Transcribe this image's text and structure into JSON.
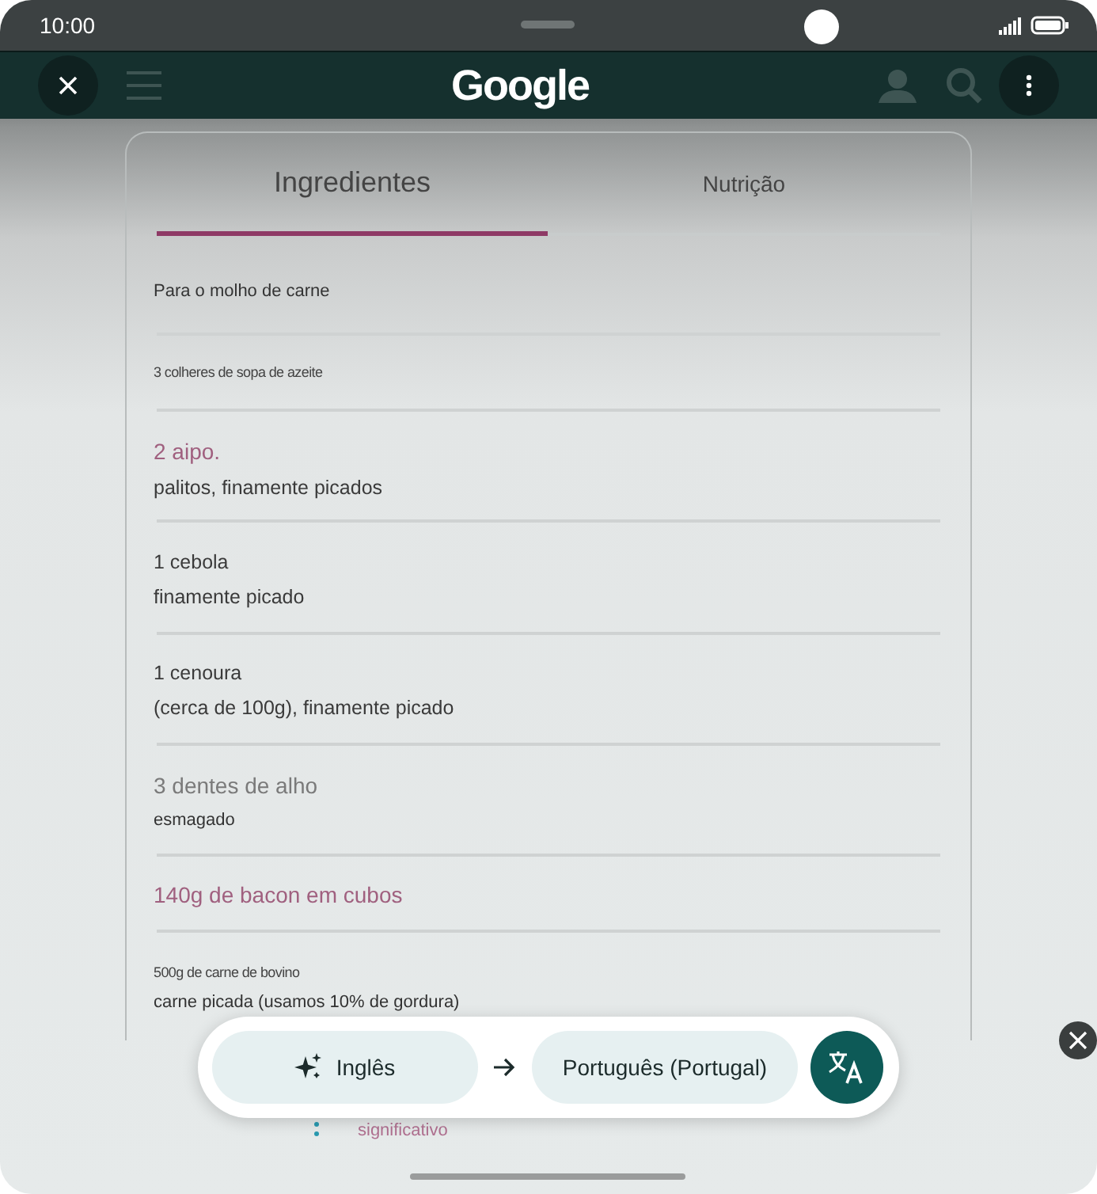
{
  "status_bar": {
    "time": "10:00"
  },
  "header": {
    "logo": "Google"
  },
  "tabs": [
    {
      "label": "Ingredientes",
      "selected": true
    },
    {
      "label": "Nutrição",
      "selected": false
    }
  ],
  "ingredients": [
    {
      "lines": [
        {
          "text": "Para o molho de carne",
          "kind": "small"
        }
      ]
    },
    {
      "lines": [
        {
          "text": "3 colheres de sopa de azeite",
          "kind": "tiny"
        }
      ]
    },
    {
      "lines": [
        {
          "text": "2 aipo.",
          "kind": "accent"
        },
        {
          "text": "palitos, finamente picados",
          "kind": "normal"
        }
      ]
    },
    {
      "lines": [
        {
          "text": "1 cebola",
          "kind": "normal"
        },
        {
          "text": "finamente picado",
          "kind": "normal"
        }
      ]
    },
    {
      "lines": [
        {
          "text": "1 cenoura",
          "kind": "normal"
        },
        {
          "text": "(cerca de 100g), finamente picado",
          "kind": "normal"
        }
      ]
    },
    {
      "lines": [
        {
          "text": "3 dentes de alho",
          "kind": "muted"
        },
        {
          "text": "esmagado",
          "kind": "small"
        }
      ]
    },
    {
      "lines": [
        {
          "text": "140g de bacon em cubos",
          "kind": "accent"
        }
      ]
    },
    {
      "lines": [
        {
          "text": "500g de carne de bovino",
          "kind": "tiny"
        },
        {
          "text": "carne picada (usamos 10% de gordura)",
          "kind": "small"
        }
      ]
    }
  ],
  "below": {
    "text": "significativo"
  },
  "translate_bar": {
    "source": "Inglês",
    "target": "Português (Portugal)"
  }
}
